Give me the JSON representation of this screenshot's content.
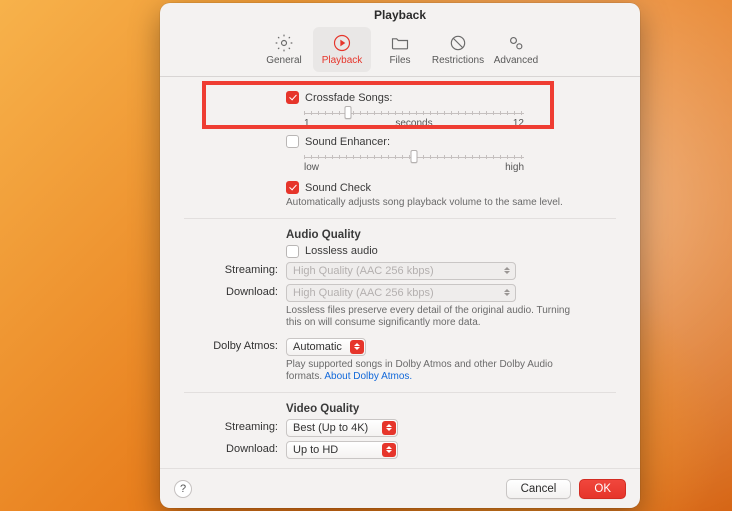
{
  "window": {
    "title": "Playback"
  },
  "tabs": {
    "general": "General",
    "playback": "Playback",
    "files": "Files",
    "restrictions": "Restrictions",
    "advanced": "Advanced"
  },
  "crossfade": {
    "label": "Crossfade Songs:",
    "checked": true,
    "min_label": "1",
    "unit_label": "seconds",
    "max_label": "12",
    "thumb_pct": 20
  },
  "enhancer": {
    "label": "Sound Enhancer:",
    "checked": false,
    "low_label": "low",
    "high_label": "high",
    "thumb_pct": 50
  },
  "sound_check": {
    "label": "Sound Check",
    "checked": true,
    "desc": "Automatically adjusts song playback volume to the same level."
  },
  "audio_quality": {
    "heading": "Audio Quality",
    "lossless_label": "Lossless audio",
    "lossless_checked": false,
    "streaming_label": "Streaming:",
    "streaming_value": "High Quality (AAC 256 kbps)",
    "download_label": "Download:",
    "download_value": "High Quality (AAC 256 kbps)",
    "desc": "Lossless files preserve every detail of the original audio. Turning this on will consume significantly more data."
  },
  "dolby": {
    "label": "Dolby Atmos:",
    "value": "Automatic",
    "desc": "Play supported songs in Dolby Atmos and other Dolby Audio formats.",
    "link": "About Dolby Atmos."
  },
  "video_quality": {
    "heading": "Video Quality",
    "streaming_label": "Streaming:",
    "streaming_value": "Best (Up to 4K)",
    "download_label": "Download:",
    "download_value": "Up to HD"
  },
  "footer": {
    "help": "?",
    "cancel": "Cancel",
    "ok": "OK"
  }
}
